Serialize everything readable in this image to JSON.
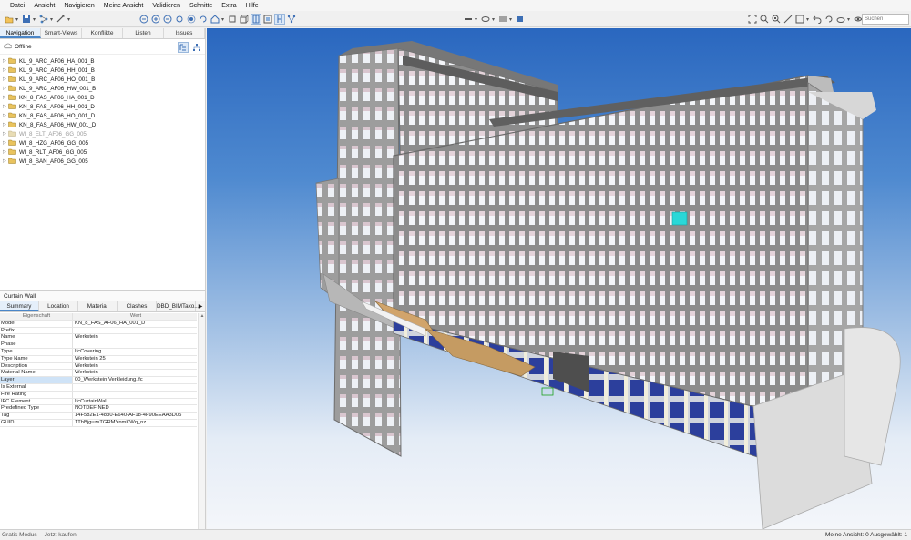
{
  "menu": [
    "Datei",
    "Ansicht",
    "Navigieren",
    "Meine Ansicht",
    "Validieren",
    "Schnitte",
    "Extra",
    "Hilfe"
  ],
  "search": {
    "placeholder": "Suchen"
  },
  "left_tabs": [
    "Navigation",
    "Smart-Views",
    "Konflikte",
    "Listen",
    "Issues"
  ],
  "navigation": {
    "status": "Offline",
    "items": [
      {
        "label": "KL_9_ARC_AF06_HA_001_B",
        "muted": false
      },
      {
        "label": "KL_9_ARC_AF06_HH_001_B",
        "muted": false
      },
      {
        "label": "KL_9_ARC_AF06_HO_001_B",
        "muted": false
      },
      {
        "label": "KL_9_ARC_AF06_HW_001_B",
        "muted": false
      },
      {
        "label": "KN_8_FAS_AF06_HA_001_D",
        "muted": false
      },
      {
        "label": "KN_8_FAS_AF06_HH_001_D",
        "muted": false
      },
      {
        "label": "KN_8_FAS_AF06_HO_001_D",
        "muted": false
      },
      {
        "label": "KN_8_FAS_AF06_HW_001_D",
        "muted": false
      },
      {
        "label": "WI_8_ELT_AF06_GG_005",
        "muted": true
      },
      {
        "label": "WI_8_HZG_AF06_GG_005",
        "muted": false
      },
      {
        "label": "WI_8_RLT_AF06_GG_005",
        "muted": false
      },
      {
        "label": "WI_8_SAN_AF06_GG_005",
        "muted": false
      }
    ]
  },
  "properties": {
    "title": "Curtain Wall",
    "tabs": [
      "Summary",
      "Location",
      "Material",
      "Clashes",
      "DBD_BIMTaxo..."
    ],
    "header": {
      "key": "Eigenschaft",
      "value": "Wert"
    },
    "rows": [
      {
        "key": "Model",
        "value": "KN_8_FAS_AF06_HA_001_D"
      },
      {
        "key": "Prefix",
        "value": ""
      },
      {
        "key": "Name",
        "value": "Werkstein"
      },
      {
        "key": "Phase",
        "value": ""
      },
      {
        "key": "Type",
        "value": "IfcCovering"
      },
      {
        "key": "Type Name",
        "value": "Werkstein 25"
      },
      {
        "key": "Description",
        "value": "Werkstein"
      },
      {
        "key": "Material Name",
        "value": "Werkstein"
      },
      {
        "key": "Layer",
        "value": "00_Werkstein Verkleidung.ifc"
      },
      {
        "key": "Is External",
        "value": ""
      },
      {
        "key": "Fire Rating",
        "value": ""
      },
      {
        "key": "IFC Element",
        "value": "IfcCurtainWall"
      },
      {
        "key": "Predefined Type",
        "value": "NOTDEFINED"
      },
      {
        "key": "Tag",
        "value": "14F582E1-4830-E640-AF18-4F90EEAA3D05"
      },
      {
        "key": "GUID",
        "value": "1ThBjguzsTGRMYnmKWq_nz"
      }
    ]
  },
  "status": {
    "left": [
      "Gratis Modus",
      "Jetzt kaufen"
    ],
    "right": "Meine Ansicht: 0  Ausgewählt: 1"
  },
  "colors": {
    "accent": "#4a86c8",
    "sky_top": "#2a67bf",
    "highlight_element": "#2ad8d8"
  },
  "icons": {
    "toolbar_left": [
      "open-icon",
      "save-icon",
      "tree-icon",
      "measure-icon"
    ],
    "toolbar_mid": [
      "zoom-fit-icon",
      "zoom-in-icon",
      "zoom-out-icon",
      "look-icon",
      "orbit-icon",
      "rotate-icon",
      "home-view-icon",
      "box-icon",
      "cube-icon",
      "section-icon",
      "section-box-icon",
      "walk-icon",
      "network-icon"
    ],
    "toolbar_right": [
      "fit-all-icon",
      "zoom-window-icon",
      "zoom-selection-icon",
      "measure-distance-icon",
      "clip-icon",
      "undo-icon",
      "rotate-model-icon",
      "cloud-icon",
      "eye-icon"
    ]
  }
}
